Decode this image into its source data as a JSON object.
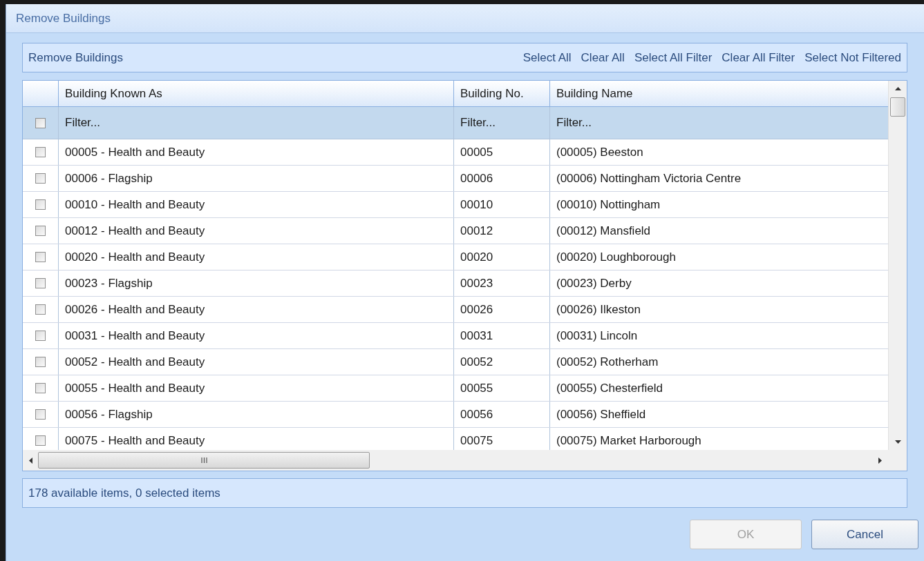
{
  "window": {
    "title": "Remove Buildings"
  },
  "panel": {
    "title": "Remove Buildings",
    "actions": [
      "Select All",
      "Clear All",
      "Select All Filter",
      "Clear All Filter",
      "Select Not Filtered"
    ]
  },
  "table": {
    "columns": [
      "Building Known As",
      "Building No.",
      "Building Name"
    ],
    "filter": {
      "checked": false,
      "placeholders": [
        "Filter...",
        "Filter...",
        "Filter..."
      ]
    },
    "rows": [
      {
        "checked": false,
        "cells": [
          "00005 - Health and Beauty",
          "00005",
          "(00005) Beeston"
        ]
      },
      {
        "checked": false,
        "cells": [
          "00006 - Flagship",
          "00006",
          "(00006) Nottingham Victoria Centre"
        ]
      },
      {
        "checked": false,
        "cells": [
          "00010 - Health and Beauty",
          "00010",
          "(00010) Nottingham"
        ]
      },
      {
        "checked": false,
        "cells": [
          "00012 - Health and Beauty",
          "00012",
          "(00012) Mansfield"
        ]
      },
      {
        "checked": false,
        "cells": [
          "00020 - Health and Beauty",
          "00020",
          "(00020) Loughborough"
        ]
      },
      {
        "checked": false,
        "cells": [
          "00023 - Flagship",
          "00023",
          "(00023) Derby"
        ]
      },
      {
        "checked": false,
        "cells": [
          "00026 - Health and Beauty",
          "00026",
          "(00026) Ilkeston"
        ]
      },
      {
        "checked": false,
        "cells": [
          "00031 - Health and Beauty",
          "00031",
          "(00031) Lincoln"
        ]
      },
      {
        "checked": false,
        "cells": [
          "00052 - Health and Beauty",
          "00052",
          "(00052) Rotherham"
        ]
      },
      {
        "checked": false,
        "cells": [
          "00055 - Health and Beauty",
          "00055",
          "(00055) Chesterfield"
        ]
      },
      {
        "checked": false,
        "cells": [
          "00056 - Flagship",
          "00056",
          "(00056) Sheffield"
        ]
      },
      {
        "checked": false,
        "cells": [
          "00075 - Health and Beauty",
          "00075",
          "(00075) Market Harborough"
        ]
      }
    ]
  },
  "status": "178 available items, 0 selected items",
  "buttons": [
    {
      "label": "OK",
      "disabled": true
    },
    {
      "label": "Cancel",
      "disabled": false
    }
  ]
}
